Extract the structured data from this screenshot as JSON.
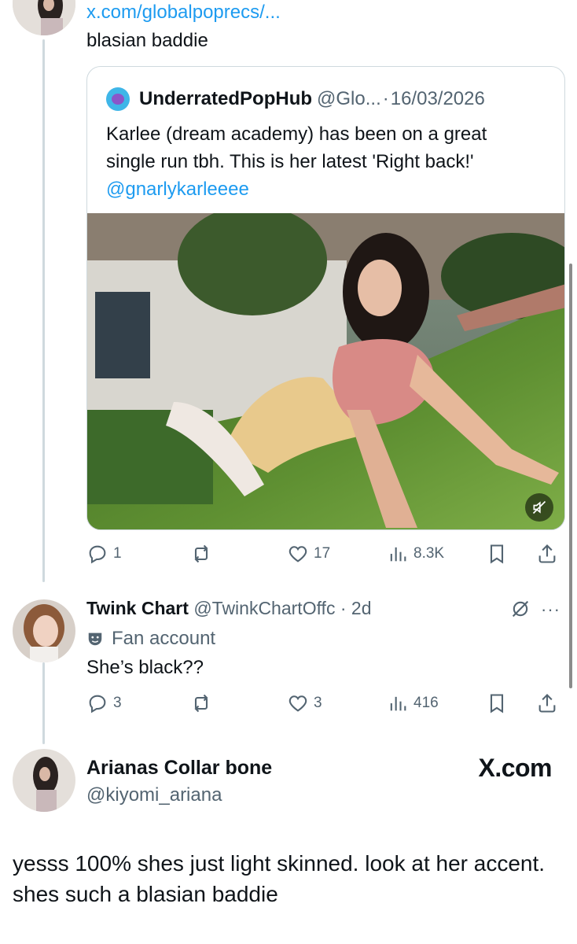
{
  "top_reply": {
    "link_text": "x.com/globalpoprecs/...",
    "text": "blasian baddie"
  },
  "quote": {
    "name": "UnderratedPopHub",
    "handle": "@Glo...",
    "separator": "·",
    "date": "16/03/2026",
    "body_line1": "Karlee (dream academy) has been on a great",
    "body_line2": "single run tbh. This is her latest 'Right back!'",
    "mention": "@gnarlykarleeee"
  },
  "quote_actions": {
    "replies": "1",
    "likes": "17",
    "views": "8.3K"
  },
  "reply": {
    "name": "Twink Chart",
    "handle": "@TwinkChartOffc",
    "separator": "·",
    "time": "2d",
    "label": "Fan account",
    "text": "She’s black??"
  },
  "reply_actions": {
    "replies": "3",
    "likes": "3",
    "views": "416"
  },
  "author": {
    "name": "Arianas Collar bone",
    "handle": "@kiyomi_ariana",
    "brand": "X.com"
  },
  "main_post": {
    "text": "yesss 100% shes just light skinned. look at her accent. shes such a blasian baddie"
  },
  "colors": {
    "link": "#1d9bf0",
    "muted": "#536471",
    "border": "#cfd9de"
  }
}
